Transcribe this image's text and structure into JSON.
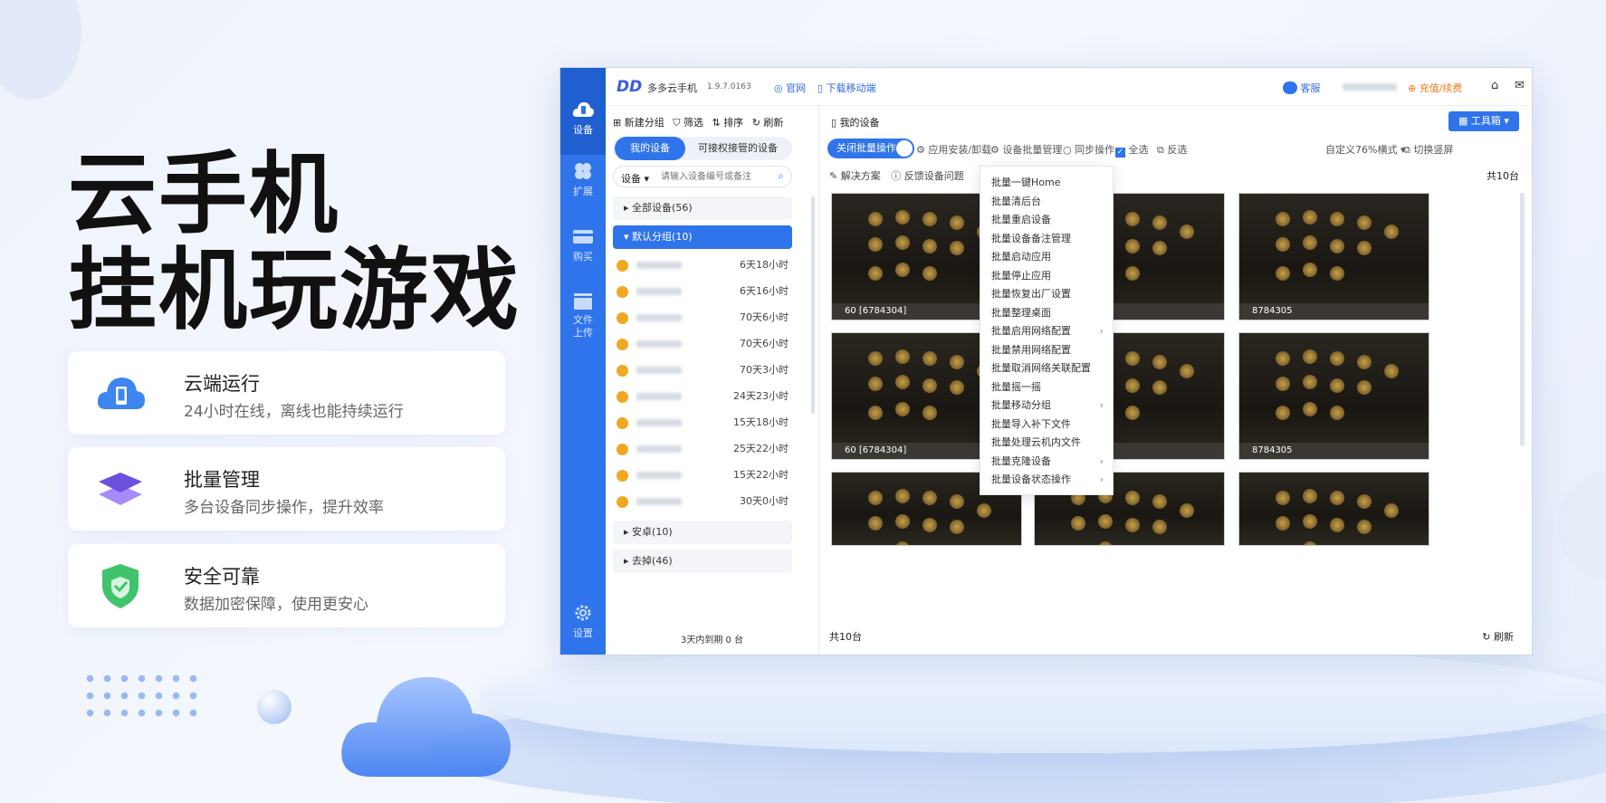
{
  "hero": {
    "line1": "云手机",
    "line2": "挂机玩游戏"
  },
  "features": [
    {
      "title": "云端运行",
      "subtitle": "24小时在线，离线也能持续运行"
    },
    {
      "title": "批量管理",
      "subtitle": "多台设备同步操作，提升效率"
    },
    {
      "title": "安全可靠",
      "subtitle": "数据加密保障，使用更安心"
    }
  ],
  "app": {
    "name": "多多云手机",
    "version": "1.9.7.0163",
    "site": "官网",
    "download": "下载移动端",
    "service": "客服",
    "recharge": "充值/续费",
    "rail": [
      {
        "label": "设备"
      },
      {
        "label": "扩展"
      },
      {
        "label": "购买"
      },
      {
        "label": "文件上传"
      },
      {
        "label": "设置"
      }
    ],
    "sidebar": {
      "toolbar": {
        "new_group": "新建分组",
        "filter": "筛选",
        "sort": "排序",
        "refresh": "刷新"
      },
      "tabs": {
        "mine": "我的设备",
        "authorized": "可接权接管的设备"
      },
      "search": {
        "type": "设备",
        "placeholder": "请输入设备编号或备注"
      },
      "groups": {
        "all": "全部设备(56)",
        "default": "默认分组(10)",
        "android": "安卓(10)",
        "other": "去掉(46)"
      },
      "devices": [
        {
          "time": "6天18小时"
        },
        {
          "time": "6天16小时"
        },
        {
          "time": "70天6小时"
        },
        {
          "time": "70天6小时"
        },
        {
          "time": "70天3小时"
        },
        {
          "time": "24天23小时"
        },
        {
          "time": "15天18小时"
        },
        {
          "time": "25天22小时"
        },
        {
          "time": "15天22小时"
        },
        {
          "time": "30天0小时"
        }
      ],
      "footer": "3天内到期 0 台"
    },
    "main": {
      "breadcrumb": "我的设备",
      "toolbox": "工具箱",
      "batch_toggle": "关闭批量操作",
      "install": "应用安装/卸载",
      "batch_mgmt": "设备批量管理",
      "sync": "同步操作",
      "select_all": "全选",
      "invert": "反选",
      "layout": "自定义76%横式",
      "switch_screen": "切换竖屏",
      "solutions": "解决方案",
      "feedback": "反馈设备问题",
      "count_top": "共10台",
      "count_bottom": "共10台",
      "refresh": "刷新",
      "thumbs": [
        {
          "label": "60 [6784304]"
        },
        {
          "label": ""
        },
        {
          "label": "8784305"
        },
        {
          "label": "60 [6784304]"
        },
        {
          "label": ""
        },
        {
          "label": "8784305"
        },
        {
          "label": ""
        },
        {
          "label": ""
        },
        {
          "label": ""
        }
      ],
      "menu": [
        {
          "label": "批量一键Home"
        },
        {
          "label": "批量清后台"
        },
        {
          "label": "批量重启设备"
        },
        {
          "label": "批量设备备注管理"
        },
        {
          "label": "批量启动应用"
        },
        {
          "label": "批量停止应用"
        },
        {
          "label": "批量恢复出厂设置"
        },
        {
          "label": "批量整理桌面"
        },
        {
          "label": "批量启用网络配置",
          "sub": true
        },
        {
          "label": "批量禁用网络配置"
        },
        {
          "label": "批量取消网络关联配置"
        },
        {
          "label": "批量摇一摇"
        },
        {
          "label": "批量移动分组",
          "sub": true
        },
        {
          "label": "批量导入补下文件"
        },
        {
          "label": "批量处理云机内文件"
        },
        {
          "label": "批量克隆设备",
          "sub": true
        },
        {
          "label": "批量设备状态操作",
          "sub": true
        }
      ]
    }
  },
  "colors": {
    "accent": "#2f74ea",
    "coin": "#f0a823",
    "recharge": "#f07c1e"
  }
}
